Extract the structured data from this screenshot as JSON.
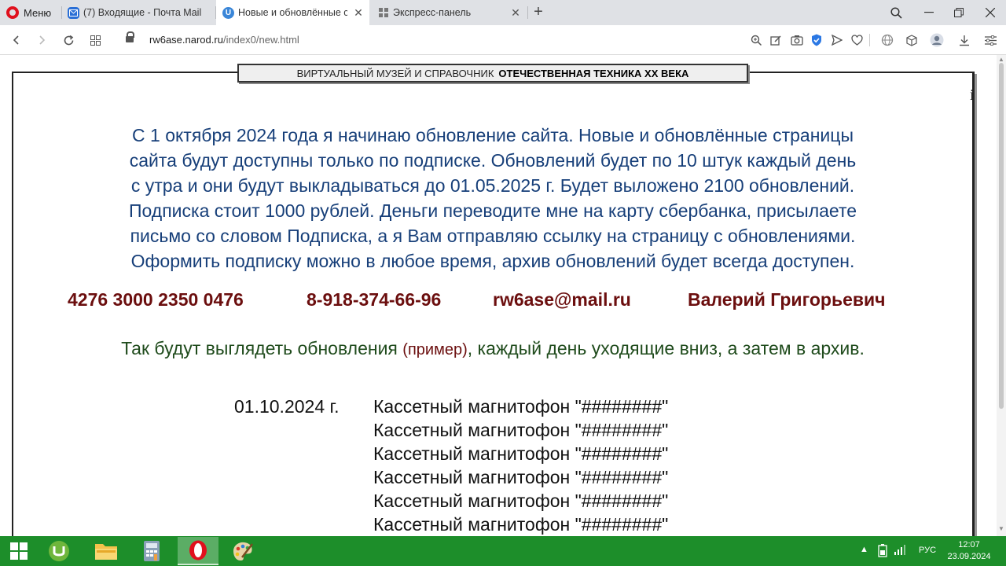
{
  "browser": {
    "menu_label": "Меню",
    "tabs": [
      {
        "title": "(7) Входящие - Почта Mail",
        "icon": "mail-icon"
      },
      {
        "title": "Новые и обновлённые стр",
        "icon": "u-site-icon"
      },
      {
        "title": "Экспресс-панель",
        "icon": "speed-dial-icon"
      }
    ],
    "url_domain": "rw6ase.narod.ru",
    "url_path": "/index0/new.html"
  },
  "page": {
    "banner_left": "ВИРТУАЛЬНЫЙ МУЗЕЙ И СПРАВОЧНИК",
    "banner_right": "ОТЕЧЕСТВЕННАЯ ТЕХНИКА XX ВЕКА",
    "stray_char": "i",
    "notice_lines": [
      "С 1 октября 2024 года я начинаю обновление сайта.  Новые и обновлённые страницы",
      "сайта будут доступны только по подписке. Обновлений будет по 10 штук каждый день",
      "с утра и они будут выкладываться до 01.05.2025 г.  Будет выложено 2100 обновлений.",
      "Подписка стоит 1000 рублей. Деньги переводите мне на карту сбербанка, присылаете",
      "письмо со словом Подписка,  а я Вам отправляю ссылку на страницу с обновлениями.",
      "Оформить подписку можно в любое время,  архив обновлений будет всегда доступен."
    ],
    "contacts": {
      "card": "4276 3000 2350 0476",
      "phone": "8-918-374-66-96",
      "email": "rw6ase@mail.ru",
      "name": "Валерий Григорьевич"
    },
    "example_pre": "Так будут выглядеть обновления ",
    "example_hl": "(пример)",
    "example_post": ", каждый день уходящие вниз, а затем в архив.",
    "update_date": "01.10.2024 г.",
    "update_items": [
      "Кассетный магнитофон \"########\"",
      "Кассетный магнитофон \"########\"",
      "Кассетный магнитофон \"########\"",
      "Кассетный магнитофон \"########\"",
      "Кассетный магнитофон \"########\"",
      "Кассетный магнитофон \"########\""
    ]
  },
  "taskbar": {
    "apps": [
      "windows-start-icon",
      "utorrent-icon",
      "file-explorer-icon",
      "calculator-icon",
      "opera-icon",
      "paint-icon"
    ],
    "language": "РУС",
    "time": "12:07",
    "date": "23.09.2024"
  },
  "colors": {
    "notice_text": "#173f79",
    "contacts_text": "#6b0e0e",
    "example_text": "#1f4b1c",
    "taskbar": "#1d8e2a"
  }
}
